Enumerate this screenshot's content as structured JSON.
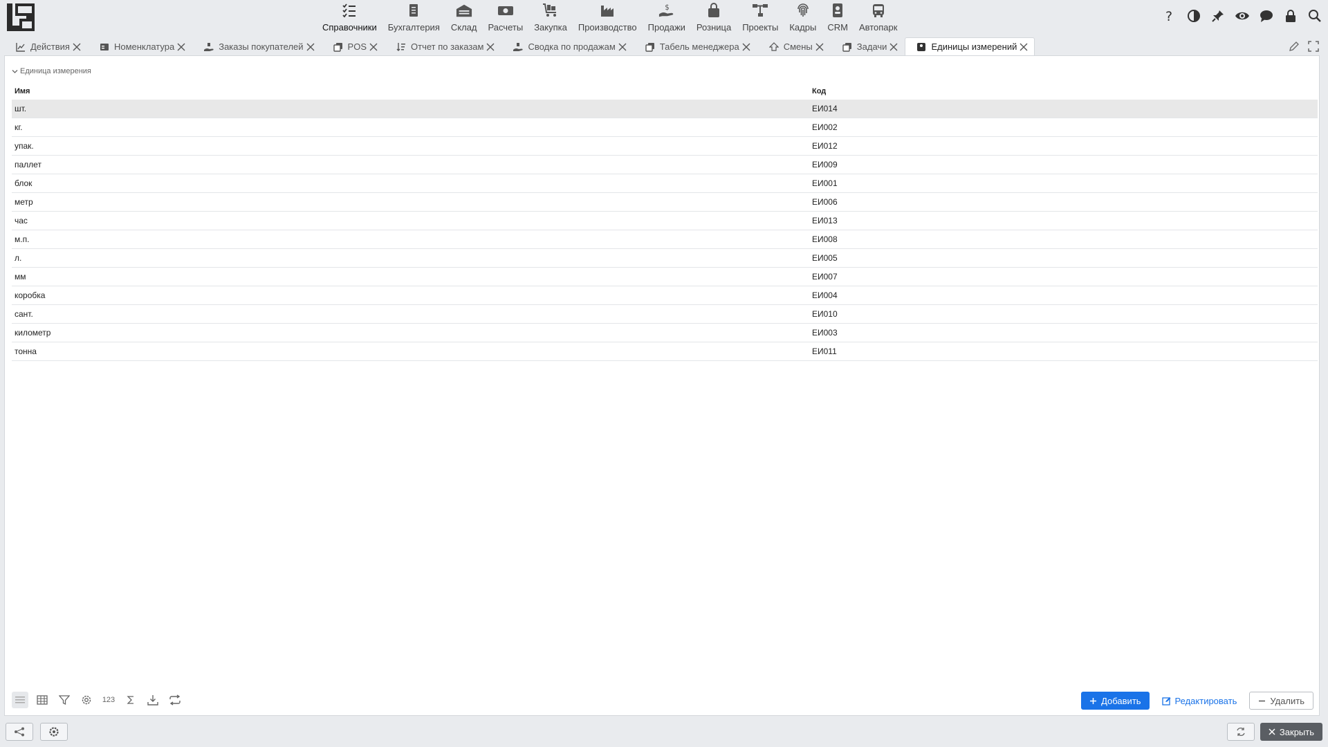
{
  "nav": {
    "modules": [
      {
        "label": "Справочники",
        "icon": "list-check-icon",
        "active": true
      },
      {
        "label": "Бухгалтерия",
        "icon": "ledger-icon"
      },
      {
        "label": "Склад",
        "icon": "warehouse-icon"
      },
      {
        "label": "Расчеты",
        "icon": "money-icon"
      },
      {
        "label": "Закупка",
        "icon": "cart-icon"
      },
      {
        "label": "Производство",
        "icon": "factory-icon"
      },
      {
        "label": "Продажи",
        "icon": "hand-dollar-icon"
      },
      {
        "label": "Розница",
        "icon": "shopping-bag-icon"
      },
      {
        "label": "Проекты",
        "icon": "project-tree-icon"
      },
      {
        "label": "Кадры",
        "icon": "fingerprint-icon"
      },
      {
        "label": "CRM",
        "icon": "contact-card-icon"
      },
      {
        "label": "Автопарк",
        "icon": "bus-icon"
      }
    ],
    "right_tools": [
      "help-icon",
      "contrast-icon",
      "pin-icon",
      "eye-icon",
      "chat-icon",
      "lock-icon",
      "search-icon"
    ]
  },
  "tabs": [
    {
      "label": "Действия",
      "icon": "chart-icon"
    },
    {
      "label": "Номенклатура",
      "icon": "catalog-icon"
    },
    {
      "label": "Заказы покупателей",
      "icon": "hand-order-icon"
    },
    {
      "label": "POS",
      "icon": "copy-icon"
    },
    {
      "label": "Отчет по заказам",
      "icon": "sort-icon"
    },
    {
      "label": "Сводка по продажам",
      "icon": "hand-order-icon"
    },
    {
      "label": "Табель менеджера",
      "icon": "copy-icon"
    },
    {
      "label": "Смены",
      "icon": "shift-icon"
    },
    {
      "label": "Задачи",
      "icon": "copy-icon"
    },
    {
      "label": "Единицы измерений",
      "icon": "weight-icon",
      "active": true
    }
  ],
  "panel": {
    "group_label": "Единица измерения",
    "columns": {
      "name": "Имя",
      "code": "Код"
    },
    "rows": [
      {
        "name": "шт.",
        "code": "ЕИ014"
      },
      {
        "name": "кг.",
        "code": "ЕИ002"
      },
      {
        "name": "упак.",
        "code": "ЕИ012"
      },
      {
        "name": "паллет",
        "code": "ЕИ009"
      },
      {
        "name": "блок",
        "code": "ЕИ001"
      },
      {
        "name": "метр",
        "code": "ЕИ006"
      },
      {
        "name": "час",
        "code": "ЕИ013"
      },
      {
        "name": "м.п.",
        "code": "ЕИ008"
      },
      {
        "name": "л.",
        "code": "ЕИ005"
      },
      {
        "name": "мм",
        "code": "ЕИ007"
      },
      {
        "name": "коробка",
        "code": "ЕИ004"
      },
      {
        "name": "сант.",
        "code": "ЕИ010"
      },
      {
        "name": "километр",
        "code": "ЕИ003"
      },
      {
        "name": "тонна",
        "code": "ЕИ011"
      }
    ],
    "selected_row": 0
  },
  "grid_tools": {
    "count_label": "123"
  },
  "actions": {
    "add": "Добавить",
    "edit": "Редактировать",
    "delete": "Удалить"
  },
  "footer": {
    "close": "Закрыть"
  },
  "colors": {
    "accent": "#1a73e8",
    "selected_row": "#e8e8e8"
  }
}
